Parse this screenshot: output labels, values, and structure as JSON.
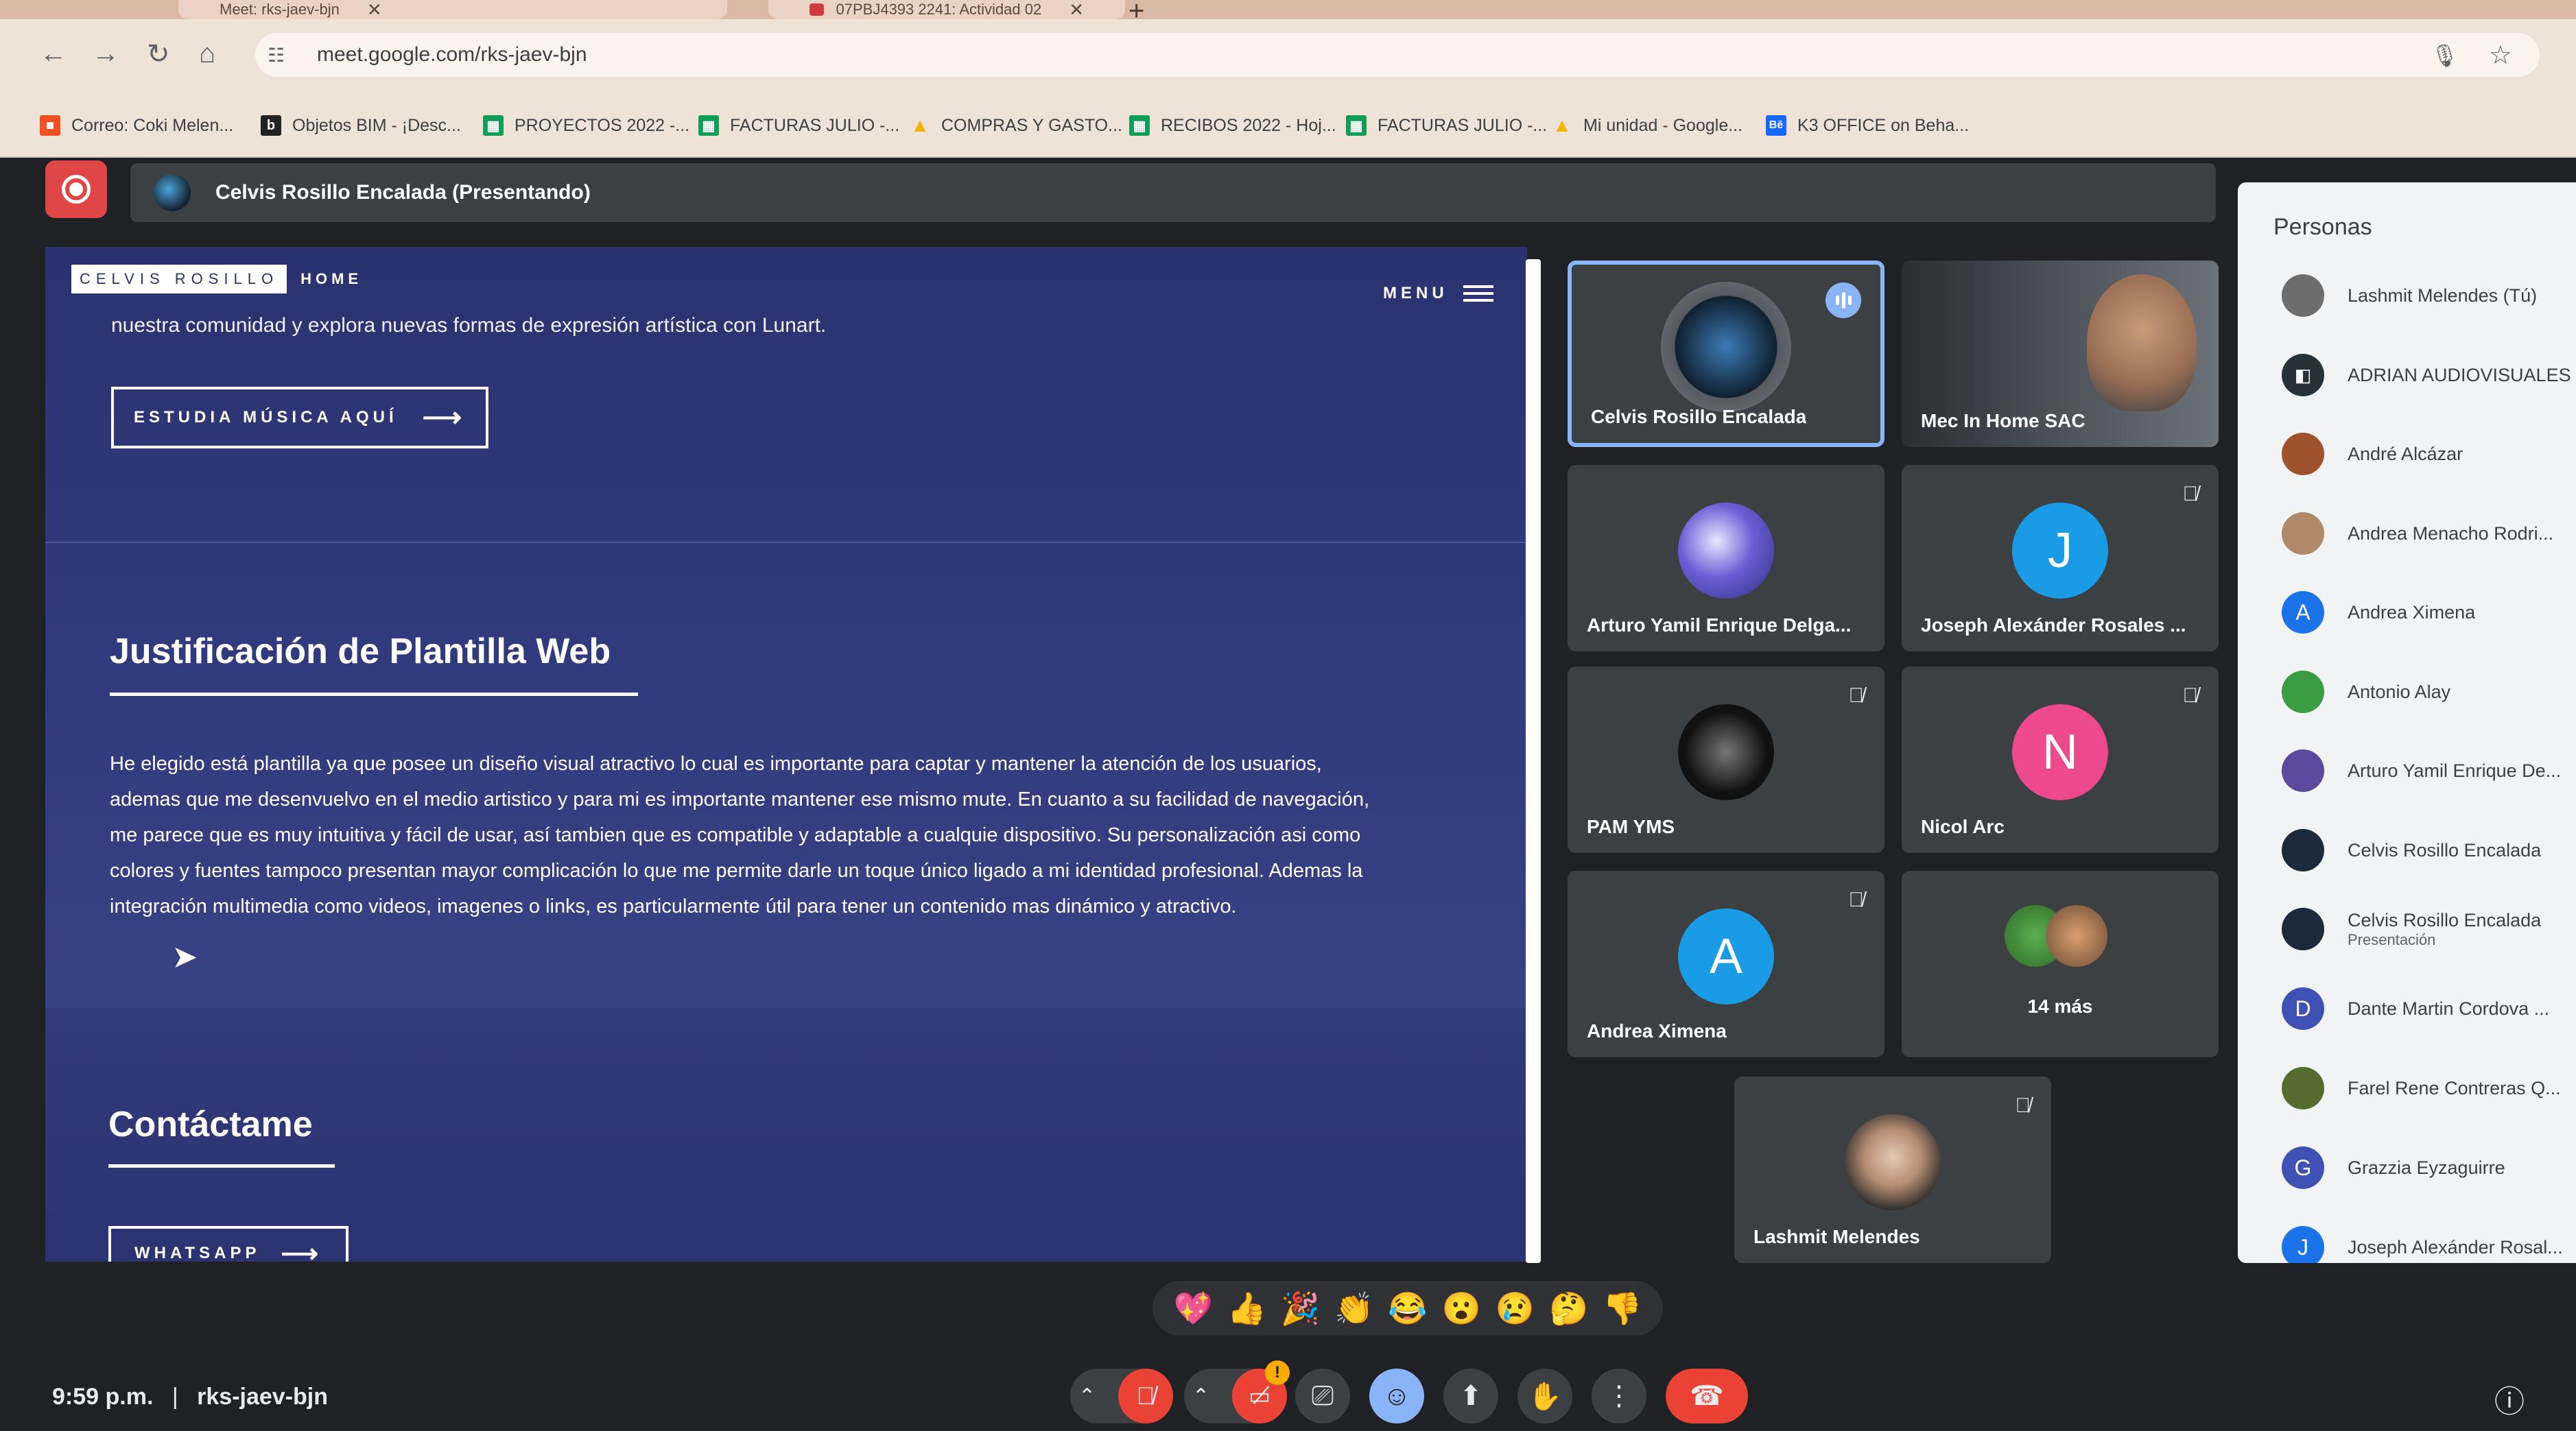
{
  "browser": {
    "tabs": [
      {
        "label": "Meet: rks-jaev-bjn"
      },
      {
        "label": "07PBJ4393 2241: Actividad 02"
      }
    ],
    "url": "meet.google.com/rks-jaev-bjn",
    "bookmarks": [
      {
        "label": "Correo: Coki Melen...",
        "icon": "microsoft-icon",
        "color": "#f25022"
      },
      {
        "label": "Objetos BIM - ¡Desc...",
        "icon": "b-icon",
        "color": "#222222"
      },
      {
        "label": "PROYECTOS 2022 -...",
        "icon": "sheets-icon",
        "color": "#0f9d58"
      },
      {
        "label": "FACTURAS JULIO -...",
        "icon": "sheets-icon",
        "color": "#0f9d58"
      },
      {
        "label": "COMPRAS Y GASTO...",
        "icon": "drive-icon",
        "color": "#fbbc04"
      },
      {
        "label": "RECIBOS 2022 - Hoj...",
        "icon": "sheets-icon",
        "color": "#0f9d58"
      },
      {
        "label": "FACTURAS JULIO -...",
        "icon": "sheets-icon",
        "color": "#0f9d58"
      },
      {
        "label": "Mi unidad - Google...",
        "icon": "drive-icon",
        "color": "#fbbc04"
      },
      {
        "label": "K3 OFFICE on Beha...",
        "icon": "behance-icon",
        "color": "#1769ff"
      }
    ]
  },
  "meet": {
    "presenter_label": "Celvis Rosillo Encalada (Presentando)",
    "shared_screen": {
      "brand": "CELVIS ROSILLO",
      "home": "HOME",
      "menu": "MENU",
      "lead": "nuestra comunidad y explora nuevas formas de expresión artística con Lunart.",
      "cta": "ESTUDIA MÚSICA AQUÍ",
      "heading": "Justificación de Plantilla Web",
      "paragraph_lines": [
        "He elegido está plantilla ya que posee un diseño visual atractivo lo cual es importante para captar y mantener la atención de los usuarios,",
        "ademas que me desenvuelvo en el medio artistico y para mi es importante mantener ese mismo mute. En cuanto a su facilidad de navegación,",
        "me parece que es muy intuitiva y fácil de usar, así tambien que es compatible y adaptable a cualquie dispositivo. Su personalización asi como",
        "colores y fuentes tampoco presentan mayor complicación lo que me permite darle un toque único ligado a mi identidad profesional. Ademas la",
        "integración multimedia como videos, imagenes o links, es particularmente útil para tener un contenido mas dinámico y atractivo."
      ],
      "contact_heading": "Contáctame",
      "whatsapp": "WHATSAPP"
    },
    "tiles": [
      {
        "name": "Celvis Rosillo Encalada",
        "speaking": true
      },
      {
        "name": "Mec In Home SAC"
      },
      {
        "name": "Arturo Yamil Enrique Delga..."
      },
      {
        "name": "Joseph Alexánder Rosales ...",
        "initial": "J",
        "color": "#1a9be6",
        "muted": true
      },
      {
        "name": "PAM YMS",
        "muted": true
      },
      {
        "name": "Nicol Arc",
        "initial": "N",
        "color": "#ec4a8c",
        "muted": true
      },
      {
        "name": "Andrea Ximena",
        "initial": "A",
        "color": "#1a9be6",
        "muted": true
      },
      {
        "more": "14 más"
      },
      {
        "name": "Lashmit Melendes",
        "muted": true
      }
    ],
    "people": {
      "title": "Personas",
      "list": [
        {
          "name": "Lashmit Melendes (Tú)",
          "color": "#6d6d6d"
        },
        {
          "name": "ADRIAN AUDIOVISUALES",
          "color": "#263238"
        },
        {
          "name": "André Alcázar",
          "color": "#a0522d"
        },
        {
          "name": "Andrea Menacho Rodri...",
          "color": "#b08968"
        },
        {
          "name": "Andrea Ximena",
          "initial": "A",
          "color": "#1a73e8"
        },
        {
          "name": "Antonio Alay",
          "color": "#3a9d44"
        },
        {
          "name": "Arturo Yamil Enrique De...",
          "color": "#5b4a9e"
        },
        {
          "name": "Celvis Rosillo Encalada",
          "color": "#1c2a3c"
        },
        {
          "name": "Celvis Rosillo Encalada",
          "sub": "Presentación",
          "color": "#1c2a3c"
        },
        {
          "name": "Dante Martin Cordova ...",
          "initial": "D",
          "color": "#3f51b5"
        },
        {
          "name": "Farel Rene Contreras Q...",
          "color": "#556b2f"
        },
        {
          "name": "Grazzia Eyzaguirre",
          "initial": "G",
          "color": "#3f51b5"
        },
        {
          "name": "Joseph Alexánder Rosal...",
          "initial": "J",
          "color": "#1a73e8"
        }
      ]
    },
    "reactions": [
      "💖",
      "👍",
      "🎉",
      "👏",
      "😂",
      "😮",
      "😢",
      "🤔",
      "👎"
    ],
    "clock": "9:59 p.m.",
    "meeting_code": "rks-jaev-bjn",
    "separator": "|",
    "badge_count": "!"
  }
}
